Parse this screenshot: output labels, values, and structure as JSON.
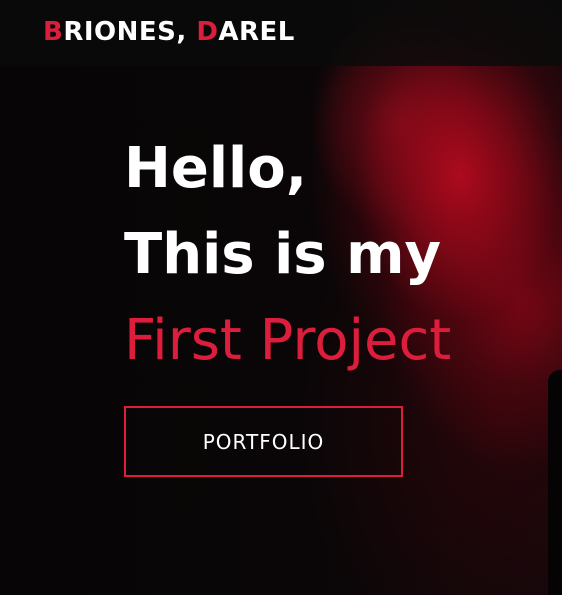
{
  "header": {
    "brand_first_initial": "B",
    "brand_first_rest": "RIONES, ",
    "brand_last_initial": "D",
    "brand_last_rest": "AREL"
  },
  "hero": {
    "line1": "Hello,",
    "line2": "This is my",
    "line3": "First Project",
    "cta_label": "PORTFOLIO"
  },
  "colors": {
    "accent": "#dc1e3c",
    "text": "#ffffff",
    "background": "#080506",
    "smoke": "#b40a1e"
  }
}
